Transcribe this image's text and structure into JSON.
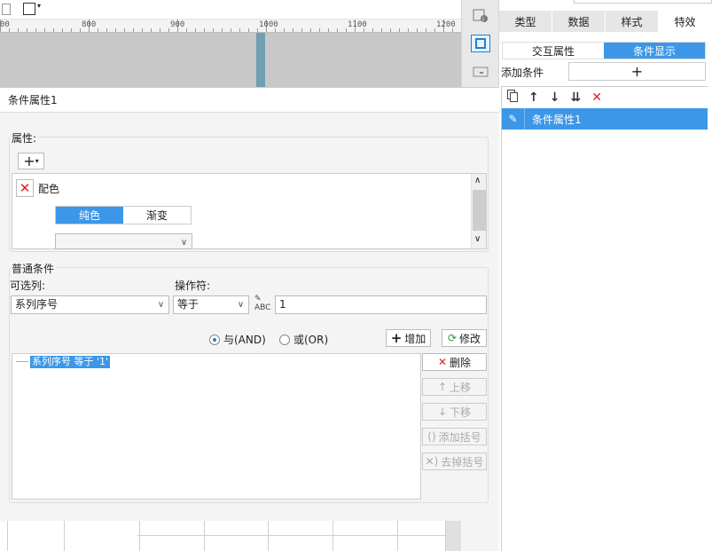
{
  "ruler": {
    "labels": [
      "00",
      "800",
      "900",
      "1000",
      "1100",
      "1200"
    ]
  },
  "right_panel": {
    "tabs": [
      "类型",
      "数据",
      "样式",
      "特效"
    ],
    "subtabs": [
      "交互属性",
      "条件显示"
    ],
    "add_condition_label": "添加条件",
    "add_button": "+",
    "list_items": [
      {
        "label": "条件属性1"
      }
    ]
  },
  "dialog": {
    "title": "条件属性1",
    "attributes_label": "属性:",
    "add_attr": "+",
    "property_name": "配色",
    "color_modes": [
      "纯色",
      "渐变"
    ],
    "general_conditions_label": "普通条件",
    "optional_column_label": "可选列:",
    "optional_column_value": "系列序号",
    "operator_label": "操作符:",
    "operator_value": "等于",
    "value_input": "1",
    "radio_and": "与(AND)",
    "radio_or": "或(OR)",
    "add_button": "增加",
    "modify_button": "修改",
    "delete_button": "删除",
    "move_up_button": "上移",
    "move_down_button": "下移",
    "add_bracket_button": "添加括号",
    "remove_bracket_button": "去掉括号",
    "condition_row": "系列序号 等于 '1'"
  },
  "colors": {
    "accent": "#3c97e8",
    "delete": "#e02020"
  }
}
